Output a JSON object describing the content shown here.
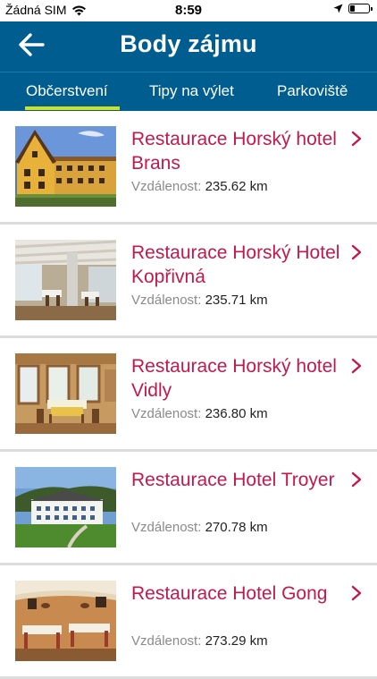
{
  "status": {
    "carrier": "Žádná SIM",
    "time": "8:59",
    "battery_level": 0.25
  },
  "header": {
    "title": "Body zájmu",
    "back_icon": "arrow-left-icon",
    "background": "#005d8f"
  },
  "tabs": [
    {
      "label": "Občerstvení",
      "active": true
    },
    {
      "label": "Tipy na výlet",
      "active": false
    },
    {
      "label": "Parkoviště",
      "active": false
    }
  ],
  "accent": {
    "tab_indicator": "#cfe21a",
    "item_title": "#c2194c"
  },
  "items": [
    {
      "name": "Restaurace Horský hotel Brans",
      "distance_label": "Vzdálenost:",
      "distance": "235.62 km"
    },
    {
      "name": "Restaurace Horský Hotel Kopřivná",
      "distance_label": "Vzdálenost:",
      "distance": "235.71 km"
    },
    {
      "name": "Restaurace Horský hotel Vidly",
      "distance_label": "Vzdálenost:",
      "distance": "236.80 km"
    },
    {
      "name": "Restaurace Hotel Troyer",
      "distance_label": "Vzdálenost:",
      "distance": "270.78 km"
    },
    {
      "name": "Restaurace Hotel Gong",
      "distance_label": "Vzdálenost:",
      "distance": "273.29 km"
    }
  ]
}
